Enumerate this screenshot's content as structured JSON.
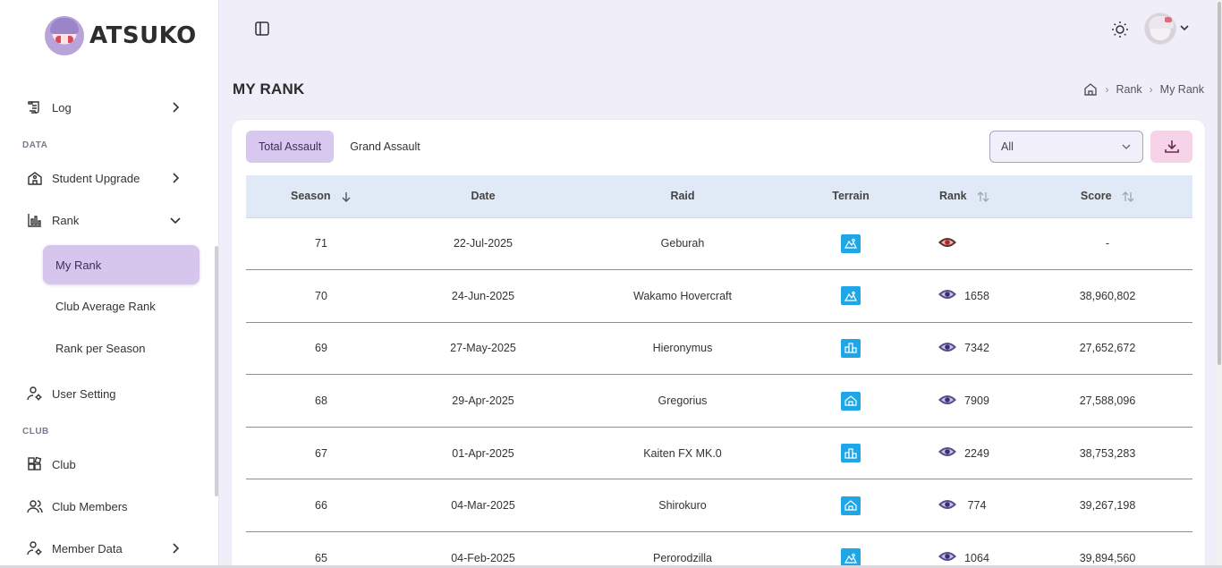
{
  "brand": {
    "name": "ATSUKO"
  },
  "sidebar": {
    "log": {
      "label": "Log"
    },
    "sections": {
      "data": "DATA",
      "club": "CLUB"
    },
    "student_upgrade": {
      "label": "Student Upgrade"
    },
    "rank": {
      "label": "Rank"
    },
    "rank_sub": [
      {
        "label": "My Rank",
        "active": true
      },
      {
        "label": "Club Average Rank",
        "active": false
      },
      {
        "label": "Rank per Season",
        "active": false
      }
    ],
    "user_setting": {
      "label": "User Setting"
    },
    "club": {
      "label": "Club"
    },
    "club_members": {
      "label": "Club Members"
    },
    "member_data": {
      "label": "Member Data"
    }
  },
  "page": {
    "title": "MY RANK",
    "breadcrumb": [
      "Rank",
      "My Rank"
    ]
  },
  "tabs": [
    "Total Assault",
    "Grand Assault"
  ],
  "filter": {
    "value": "All"
  },
  "table": {
    "headers": [
      "Season",
      "Date",
      "Raid",
      "Terrain",
      "Rank",
      "Score"
    ],
    "rows": [
      {
        "season": "71",
        "date": "22-Jul-2025",
        "raid": "Geburah",
        "terrain": "outdoor-mountain-icon",
        "rank": "",
        "score": "-"
      },
      {
        "season": "70",
        "date": "24-Jun-2025",
        "raid": "Wakamo Hovercraft",
        "terrain": "outdoor-mountain-icon",
        "rank": "1658",
        "score": "38,960,802"
      },
      {
        "season": "69",
        "date": "27-May-2025",
        "raid": "Hieronymus",
        "terrain": "urban-buildings-icon",
        "rank": "7342",
        "score": "27,652,672"
      },
      {
        "season": "68",
        "date": "29-Apr-2025",
        "raid": "Gregorius",
        "terrain": "indoor-house-icon",
        "rank": "7909",
        "score": "27,588,096"
      },
      {
        "season": "67",
        "date": "01-Apr-2025",
        "raid": "Kaiten FX MK.0",
        "terrain": "urban-buildings-icon",
        "rank": "2249",
        "score": "38,753,283"
      },
      {
        "season": "66",
        "date": "04-Mar-2025",
        "raid": "Shirokuro",
        "terrain": "indoor-house-icon",
        "rank": "774",
        "score": "39,267,198"
      },
      {
        "season": "65",
        "date": "04-Feb-2025",
        "raid": "Perorodzilla",
        "terrain": "outdoor-mountain-icon",
        "rank": "1064",
        "score": "39,894,560"
      }
    ]
  },
  "colors": {
    "accent": "#d8c8ef",
    "header_bg": "#dfeaf6",
    "terrain_blue": "#1ea6e6",
    "download_bg": "#f6d3e8"
  }
}
